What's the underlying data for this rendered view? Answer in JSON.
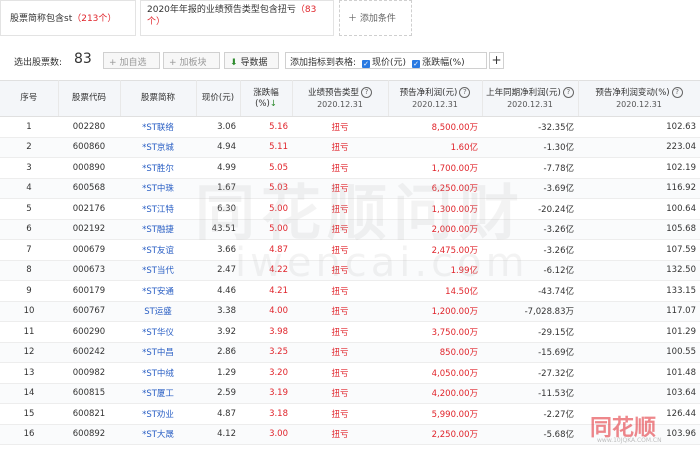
{
  "conditions": [
    {
      "text": "股票简称包含st",
      "count": "（213个）"
    },
    {
      "text": "2020年年报的业绩预告类型包含扭亏",
      "count": "（83个）"
    }
  ],
  "add_condition": "添加条件",
  "toolbar": {
    "selected_label": "选出股票数:",
    "selected_count": "83",
    "add_watch": "加自选",
    "add_board": "加板块",
    "export": "导数据",
    "add_indicator_label": "添加指标到表格:",
    "ind_price": "现价(元)",
    "ind_change": "涨跌幅(%)",
    "plus": "+"
  },
  "columns": {
    "seq": "序号",
    "code": "股票代码",
    "name": "股票简称",
    "price": "现价(元)",
    "change": "涨跌幅(%)",
    "forecast_type": "业绩预告类型",
    "forecast_type_date": "2020.12.31",
    "forecast_profit": "预告净利润(元)",
    "forecast_profit_date": "2020.12.31",
    "last_profit": "上年同期净利润(元)",
    "last_profit_date": "2020.12.31",
    "profit_change": "预告净利润变动(%)",
    "profit_change_date": "2020.12.31"
  },
  "rows": [
    {
      "seq": "1",
      "code": "002280",
      "name": "*ST联络",
      "price": "3.06",
      "change": "5.16",
      "type": "扭亏",
      "forecast": "8,500.00万",
      "last": "-32.35亿",
      "pct": "102.63"
    },
    {
      "seq": "2",
      "code": "600860",
      "name": "*ST京城",
      "price": "4.94",
      "change": "5.11",
      "type": "扭亏",
      "forecast": "1.60亿",
      "last": "-1.30亿",
      "pct": "223.04"
    },
    {
      "seq": "3",
      "code": "000890",
      "name": "*ST胜尔",
      "price": "4.99",
      "change": "5.05",
      "type": "扭亏",
      "forecast": "1,700.00万",
      "last": "-7.78亿",
      "pct": "102.19"
    },
    {
      "seq": "4",
      "code": "600568",
      "name": "*ST中珠",
      "price": "1.67",
      "change": "5.03",
      "type": "扭亏",
      "forecast": "6,250.00万",
      "last": "-3.69亿",
      "pct": "116.92"
    },
    {
      "seq": "5",
      "code": "002176",
      "name": "*ST江特",
      "price": "6.30",
      "change": "5.00",
      "type": "扭亏",
      "forecast": "1,300.00万",
      "last": "-20.24亿",
      "pct": "100.64"
    },
    {
      "seq": "6",
      "code": "002192",
      "name": "*ST融捷",
      "price": "43.51",
      "change": "5.00",
      "type": "扭亏",
      "forecast": "2,000.00万",
      "last": "-3.26亿",
      "pct": "105.68"
    },
    {
      "seq": "7",
      "code": "000679",
      "name": "*ST友谊",
      "price": "3.66",
      "change": "4.87",
      "type": "扭亏",
      "forecast": "2,475.00万",
      "last": "-3.26亿",
      "pct": "107.59"
    },
    {
      "seq": "8",
      "code": "000673",
      "name": "*ST当代",
      "price": "2.47",
      "change": "4.22",
      "type": "扭亏",
      "forecast": "1.99亿",
      "last": "-6.12亿",
      "pct": "132.50"
    },
    {
      "seq": "9",
      "code": "600179",
      "name": "*ST安通",
      "price": "4.46",
      "change": "4.21",
      "type": "扭亏",
      "forecast": "14.50亿",
      "last": "-43.74亿",
      "pct": "133.15"
    },
    {
      "seq": "10",
      "code": "600767",
      "name": "ST运盛",
      "price": "3.38",
      "change": "4.00",
      "type": "扭亏",
      "forecast": "1,200.00万",
      "last": "-7,028.83万",
      "pct": "117.07"
    },
    {
      "seq": "11",
      "code": "600290",
      "name": "*ST华仪",
      "price": "3.92",
      "change": "3.98",
      "type": "扭亏",
      "forecast": "3,750.00万",
      "last": "-29.15亿",
      "pct": "101.29"
    },
    {
      "seq": "12",
      "code": "600242",
      "name": "*ST中昌",
      "price": "2.86",
      "change": "3.25",
      "type": "扭亏",
      "forecast": "850.00万",
      "last": "-15.69亿",
      "pct": "100.55"
    },
    {
      "seq": "13",
      "code": "000982",
      "name": "*ST中绒",
      "price": "1.29",
      "change": "3.20",
      "type": "扭亏",
      "forecast": "4,050.00万",
      "last": "-27.32亿",
      "pct": "101.48"
    },
    {
      "seq": "14",
      "code": "600815",
      "name": "*ST厦工",
      "price": "2.59",
      "change": "3.19",
      "type": "扭亏",
      "forecast": "4,200.00万",
      "last": "-11.53亿",
      "pct": "103.64"
    },
    {
      "seq": "15",
      "code": "600821",
      "name": "*ST劝业",
      "price": "4.87",
      "change": "3.18",
      "type": "扭亏",
      "forecast": "5,990.00万",
      "last": "-2.27亿",
      "pct": "126.44"
    },
    {
      "seq": "16",
      "code": "600892",
      "name": "*ST大晟",
      "price": "4.12",
      "change": "3.00",
      "type": "扭亏",
      "forecast": "2,250.00万",
      "last": "-5.68亿",
      "pct": "103.96"
    }
  ],
  "watermark": {
    "main": "同花顺问财",
    "url": "iwencai.com",
    "logo": "同花顺",
    "logo_url": "www.10JQKA.COM.CN"
  },
  "colors": {
    "red": "#e0242b",
    "blue": "#2a5fc4",
    "green": "#2e8b2e"
  }
}
